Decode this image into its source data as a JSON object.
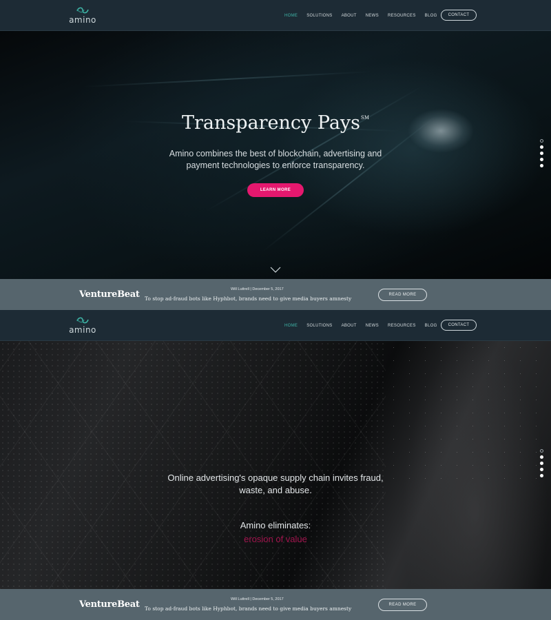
{
  "header": {
    "logo_text": "amino",
    "nav": [
      "HOME",
      "SOLUTIONS",
      "ABOUT",
      "NEWS",
      "RESOURCES",
      "BLOG"
    ],
    "contact_label": "CONTACT"
  },
  "hero1": {
    "title": "Transparency Pays",
    "title_mark": "SM",
    "subtitle": "Amino combines the best of blockchain, advertising and payment technologies to enforce transparency.",
    "button_label": "LEARN MORE"
  },
  "hero2": {
    "lead": "Online advertising's opaque supply chain invites fraud, waste, and abuse.",
    "eliminates_label": "Amino eliminates:",
    "rotating_text": "erosion of value"
  },
  "news": {
    "source": "VentureBeat",
    "meta": "Will Luttrell | December 5, 2017",
    "headline": "To stop ad-fraud bots like Hyphbot, brands need to give media buyers amnesty",
    "button_label": "READ MORE"
  },
  "colors": {
    "accent_teal": "#3fb6a8",
    "cta_pink": "#e5186e",
    "highlight_magenta": "#a3144e",
    "header_bg": "#1d2b35",
    "newsbar_bg": "#56656d"
  },
  "slider": {
    "dot_count": 5,
    "active_index_screen1": 0,
    "active_index_screen2": 0
  }
}
